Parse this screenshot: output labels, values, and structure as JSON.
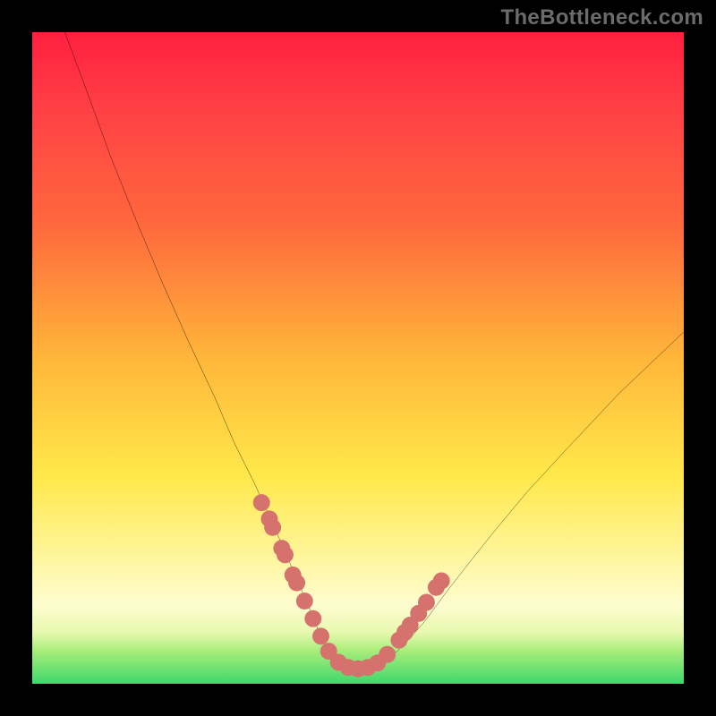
{
  "attribution": "TheBottleneck.com",
  "chart_data": {
    "type": "line",
    "title": "",
    "xlabel": "",
    "ylabel": "",
    "xlim": [
      0,
      100
    ],
    "ylim": [
      0,
      100
    ],
    "curve": {
      "name": "bottleneck-curve",
      "color": "#000000",
      "x": [
        5,
        8,
        12,
        16,
        20,
        24,
        28,
        31,
        34,
        36.5,
        38.5,
        40,
        41.5,
        43,
        44.2,
        45,
        46,
        47,
        48.3,
        50,
        52,
        54,
        56,
        58,
        60.5,
        63.5,
        67,
        71,
        76,
        82,
        90,
        100
      ],
      "y": [
        100,
        92,
        81,
        71,
        61.5,
        52.5,
        44,
        37,
        31,
        25.5,
        21,
        17.5,
        14,
        10.5,
        7.5,
        5.5,
        4,
        3.1,
        2.5,
        2.3,
        2.5,
        3.4,
        5,
        7,
        9.9,
        14,
        18.5,
        23.5,
        29.5,
        36,
        44.5,
        54
      ]
    },
    "marker_series": {
      "name": "sample-points",
      "color": "#d6726d",
      "radius_pct": 1.3,
      "x": [
        35.2,
        36.4,
        36.9,
        38.3,
        38.8,
        40.0,
        40.6,
        41.8,
        43.1,
        44.3,
        45.5,
        47.0,
        48.5,
        50.0,
        51.5,
        53.0,
        54.5,
        56.3,
        57.2,
        58.0,
        59.3,
        60.5,
        62.0,
        62.8
      ],
      "y": [
        27.8,
        25.3,
        24.0,
        20.8,
        19.8,
        16.7,
        15.5,
        12.7,
        10.0,
        7.3,
        5.0,
        3.3,
        2.5,
        2.3,
        2.5,
        3.2,
        4.5,
        6.7,
        7.9,
        9.0,
        10.8,
        12.5,
        14.8,
        15.8
      ]
    }
  }
}
